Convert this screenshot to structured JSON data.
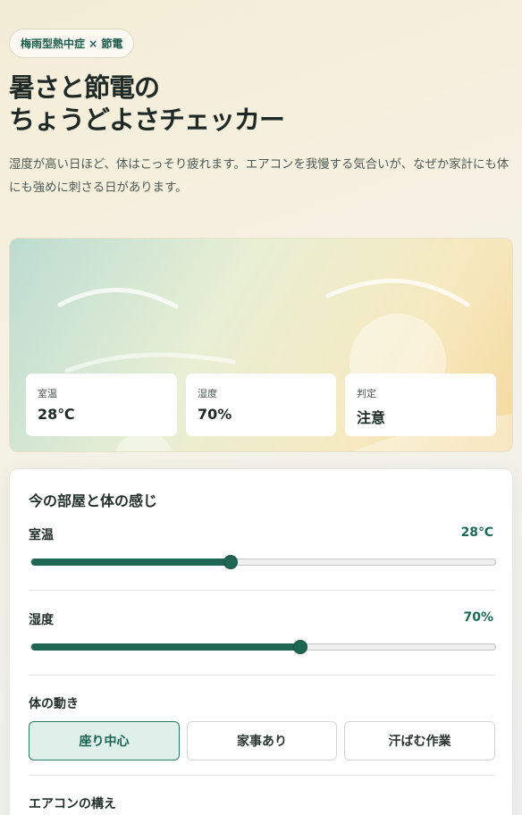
{
  "badge": {
    "label": "梅雨型熱中症 × 節電"
  },
  "header": {
    "title_line1": "暑さと節電の",
    "title_line2": "ちょうどよさチェッカー",
    "description": "湿度が高い日ほど、体はこっそり疲れます。エアコンを我慢する気合いが、なぜか家計にも体にも強めに刺さる日があります。"
  },
  "summary": {
    "temperature": {
      "label": "室温",
      "value": "28℃"
    },
    "humidity": {
      "label": "湿度",
      "value": "70%"
    },
    "verdict": {
      "label": "判定",
      "value": "注意"
    }
  },
  "panel": {
    "title": "今の部屋と体の感じ",
    "temperature_slider": {
      "label": "室温",
      "value_text": "28℃",
      "level": 0.43
    },
    "humidity_slider": {
      "label": "湿度",
      "value_text": "70%",
      "level": 0.58
    },
    "activity": {
      "label": "体の動き",
      "options": [
        "座り中心",
        "家事あり",
        "汗ばむ作業"
      ],
      "selected": "座り中心"
    },
    "aircon_label": "エアコンの構え"
  },
  "colors": {
    "accent": "#1d6653",
    "accent_light": "#dff0ea"
  }
}
